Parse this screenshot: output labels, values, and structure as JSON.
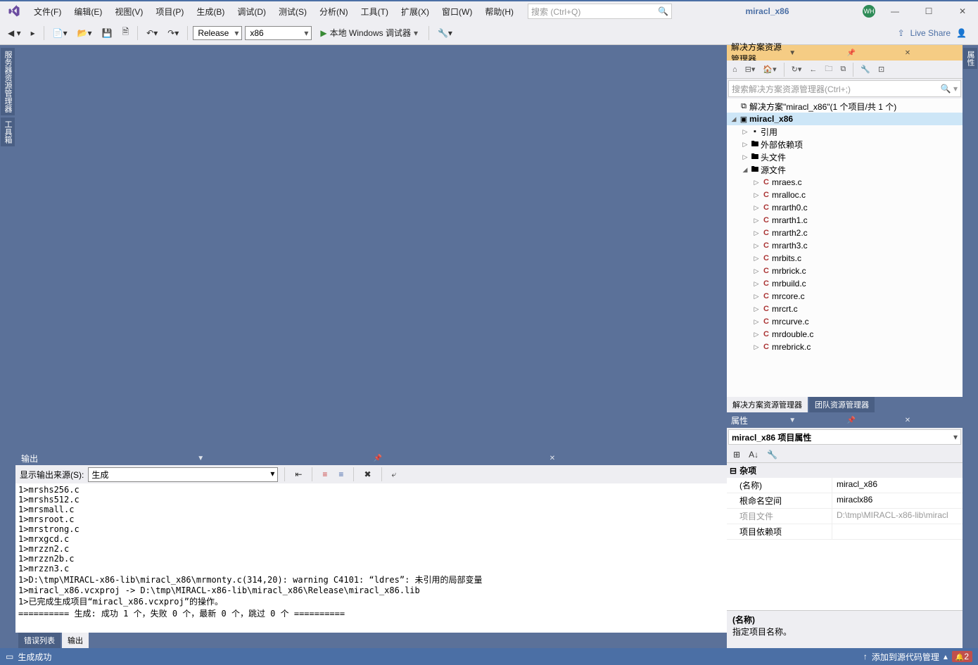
{
  "menu": {
    "items": [
      "文件(F)",
      "编辑(E)",
      "视图(V)",
      "项目(P)",
      "生成(B)",
      "调试(D)",
      "测试(S)",
      "分析(N)",
      "工具(T)",
      "扩展(X)",
      "窗口(W)",
      "帮助(H)"
    ]
  },
  "search": {
    "placeholder": "搜索 (Ctrl+Q)"
  },
  "title": "miracl_x86",
  "user_badge": "WH",
  "toolbar": {
    "config": "Release",
    "platform": "x86",
    "debug": "本地 Windows 调试器",
    "liveshare": "Live Share"
  },
  "left_tabs": [
    "服务器资源管理器",
    "工具箱"
  ],
  "right_tab": "属性",
  "output": {
    "title": "输出",
    "source_label": "显示输出来源(S):",
    "source_value": "生成",
    "lines": [
      "1>mrshs256.c",
      "1>mrshs512.c",
      "1>mrsmall.c",
      "1>mrsroot.c",
      "1>mrstrong.c",
      "1>mrxgcd.c",
      "1>mrzzn2.c",
      "1>mrzzn2b.c",
      "1>mrzzn3.c",
      "1>D:\\tmp\\MIRACL-x86-lib\\miracl_x86\\mrmonty.c(314,20): warning C4101: “ldres”: 未引用的局部变量",
      "1>miracl_x86.vcxproj -> D:\\tmp\\MIRACL-x86-lib\\miracl_x86\\Release\\miracl_x86.lib",
      "1>已完成生成项目“miracl_x86.vcxproj”的操作。",
      "========== 生成: 成功 1 个，失败 0 个，最新 0 个，跳过 0 个 =========="
    ],
    "tabs": {
      "errors": "错误列表",
      "output": "输出"
    }
  },
  "solution": {
    "title": "解决方案资源管理器",
    "search_placeholder": "搜索解决方案资源管理器(Ctrl+;)",
    "root": "解决方案\"miracl_x86\"(1 个项目/共 1 个)",
    "project": "miracl_x86",
    "folders": {
      "refs": "引用",
      "ext": "外部依赖项",
      "headers": "头文件",
      "sources": "源文件"
    },
    "files": [
      "mraes.c",
      "mralloc.c",
      "mrarth0.c",
      "mrarth1.c",
      "mrarth2.c",
      "mrarth3.c",
      "mrbits.c",
      "mrbrick.c",
      "mrbuild.c",
      "mrcore.c",
      "mrcrt.c",
      "mrcurve.c",
      "mrdouble.c",
      "mrebrick.c"
    ],
    "bottom_tabs": {
      "sol": "解决方案资源管理器",
      "team": "团队资源管理器"
    }
  },
  "props": {
    "title": "属性",
    "object": "miracl_x86 项目属性",
    "cat": "杂项",
    "rows": {
      "name_k": "(名称)",
      "name_v": "miracl_x86",
      "ns_k": "根命名空间",
      "ns_v": "miraclx86",
      "file_k": "项目文件",
      "file_v": "D:\\tmp\\MIRACL-x86-lib\\miracl",
      "dep_k": "项目依赖项",
      "dep_v": ""
    },
    "desc_title": "(名称)",
    "desc_text": "指定项目名称。"
  },
  "status": {
    "left": "生成成功",
    "right": "添加到源代码管理",
    "notif": "2"
  }
}
